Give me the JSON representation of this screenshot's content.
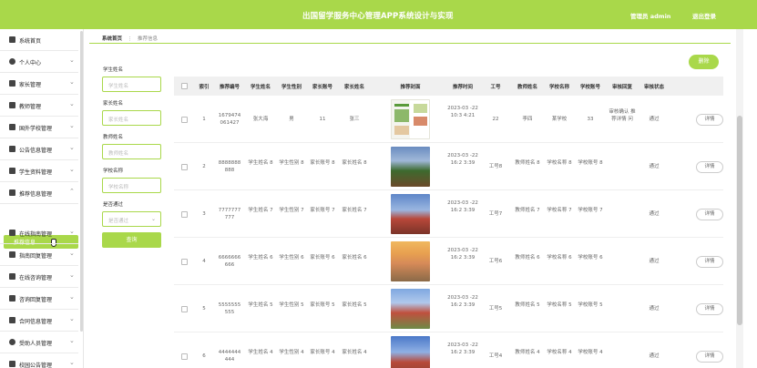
{
  "header": {
    "title": "出国留学服务中心管理APP系统设计与实现",
    "admin": "管理员 admin",
    "logout": "退出登录"
  },
  "sidebar": {
    "items": [
      {
        "label": "系统首页",
        "icon": "home-icon"
      },
      {
        "label": "个人中心",
        "icon": "user-icon"
      },
      {
        "label": "家长管理",
        "icon": "grid-icon"
      },
      {
        "label": "教师管理",
        "icon": "grid-icon"
      },
      {
        "label": "国外学校管理",
        "icon": "grid-icon"
      },
      {
        "label": "公告信息管理",
        "icon": "monitor-icon"
      },
      {
        "label": "学生资料管理",
        "icon": "grid-icon"
      },
      {
        "label": "推荐信息管理",
        "icon": "grid-icon"
      },
      {
        "label": "在线指南管理",
        "icon": "grid-icon"
      },
      {
        "label": "指南回复管理",
        "icon": "grid-icon"
      },
      {
        "label": "在线咨询管理",
        "icon": "grid-icon"
      },
      {
        "label": "咨询回复管理",
        "icon": "grid-icon"
      },
      {
        "label": "合同信息管理",
        "icon": "grid-icon"
      },
      {
        "label": "受助人员管理",
        "icon": "user-icon"
      },
      {
        "label": "校园公告管理",
        "icon": "grid-icon"
      }
    ],
    "active_sub": "推荐信息"
  },
  "breadcrumb": {
    "home": "系统首页",
    "separator": "⋮",
    "current": "推荐信息"
  },
  "toolbar": {
    "delete": "删除"
  },
  "filters": {
    "student_name": {
      "label": "学生姓名",
      "placeholder": "学生姓名"
    },
    "parent_name": {
      "label": "家长姓名",
      "placeholder": "家长姓名"
    },
    "teacher_name": {
      "label": "教师姓名",
      "placeholder": "教师姓名"
    },
    "school_name": {
      "label": "学校名称",
      "placeholder": "学校名称"
    },
    "approved": {
      "label": "是否通过",
      "placeholder": "是否通过"
    },
    "search": "查询"
  },
  "table": {
    "columns": [
      "索引",
      "推荐编号",
      "学生姓名",
      "学生性别",
      "家长账号",
      "家长姓名",
      "推荐封面",
      "推荐时间",
      "工号",
      "教师姓名",
      "学校名称",
      "学校账号",
      "审核回复",
      "审核状态"
    ],
    "rows": [
      {
        "index": "1",
        "no": "1679474 061427",
        "name": "张大海",
        "gender": "男",
        "parent_acc": "11",
        "parent_name": "张三",
        "time": "2023-03 -22 10:3 4:21",
        "staff_no": "22",
        "teacher": "李四",
        "school": "某学校",
        "school_acc": "33",
        "reply": "审核确认 推荐详情 问",
        "status": "通过",
        "action": "详情"
      },
      {
        "index": "2",
        "no": "8888888 888",
        "name": "学生姓名 8",
        "gender": "学生性别 8",
        "parent_acc": "家长账号 8",
        "parent_name": "家长姓名 8",
        "time": "2023-03 -22 16:2 3:39",
        "staff_no": "工号8",
        "teacher": "教师姓名 8",
        "school": "学校名称 8",
        "school_acc": "学校账号 8",
        "reply": "",
        "status": "通过",
        "action": "详情"
      },
      {
        "index": "3",
        "no": "7777777 777",
        "name": "学生姓名 7",
        "gender": "学生性别 7",
        "parent_acc": "家长账号 7",
        "parent_name": "家长姓名 7",
        "time": "2023-03 -22 16:2 3:39",
        "staff_no": "工号7",
        "teacher": "教师姓名 7",
        "school": "学校名称 7",
        "school_acc": "学校账号 7",
        "reply": "",
        "status": "通过",
        "action": "详情"
      },
      {
        "index": "4",
        "no": "6666666 666",
        "name": "学生姓名 6",
        "gender": "学生性别 6",
        "parent_acc": "家长账号 6",
        "parent_name": "家长姓名 6",
        "time": "2023-03 -22 16:2 3:39",
        "staff_no": "工号6",
        "teacher": "教师姓名 6",
        "school": "学校名称 6",
        "school_acc": "学校账号 6",
        "reply": "",
        "status": "通过",
        "action": "详情"
      },
      {
        "index": "5",
        "no": "5555555 555",
        "name": "学生姓名 5",
        "gender": "学生性别 5",
        "parent_acc": "家长账号 5",
        "parent_name": "家长姓名 5",
        "time": "2023-03 -22 16:2 3:39",
        "staff_no": "工号5",
        "teacher": "教师姓名 5",
        "school": "学校名称 5",
        "school_acc": "学校账号 5",
        "reply": "",
        "status": "通过",
        "action": "详情"
      },
      {
        "index": "6",
        "no": "4444444 444",
        "name": "学生姓名 4",
        "gender": "学生性别 4",
        "parent_acc": "家长账号 4",
        "parent_name": "家长姓名 4",
        "time": "2023-03 -22 16:2 3:39",
        "staff_no": "工号4",
        "teacher": "教师姓名 4",
        "school": "学校名称 4",
        "school_acc": "学校账号 4",
        "reply": "",
        "status": "通过",
        "action": "详情"
      }
    ]
  },
  "colors": {
    "accent": "#a9d84a"
  }
}
